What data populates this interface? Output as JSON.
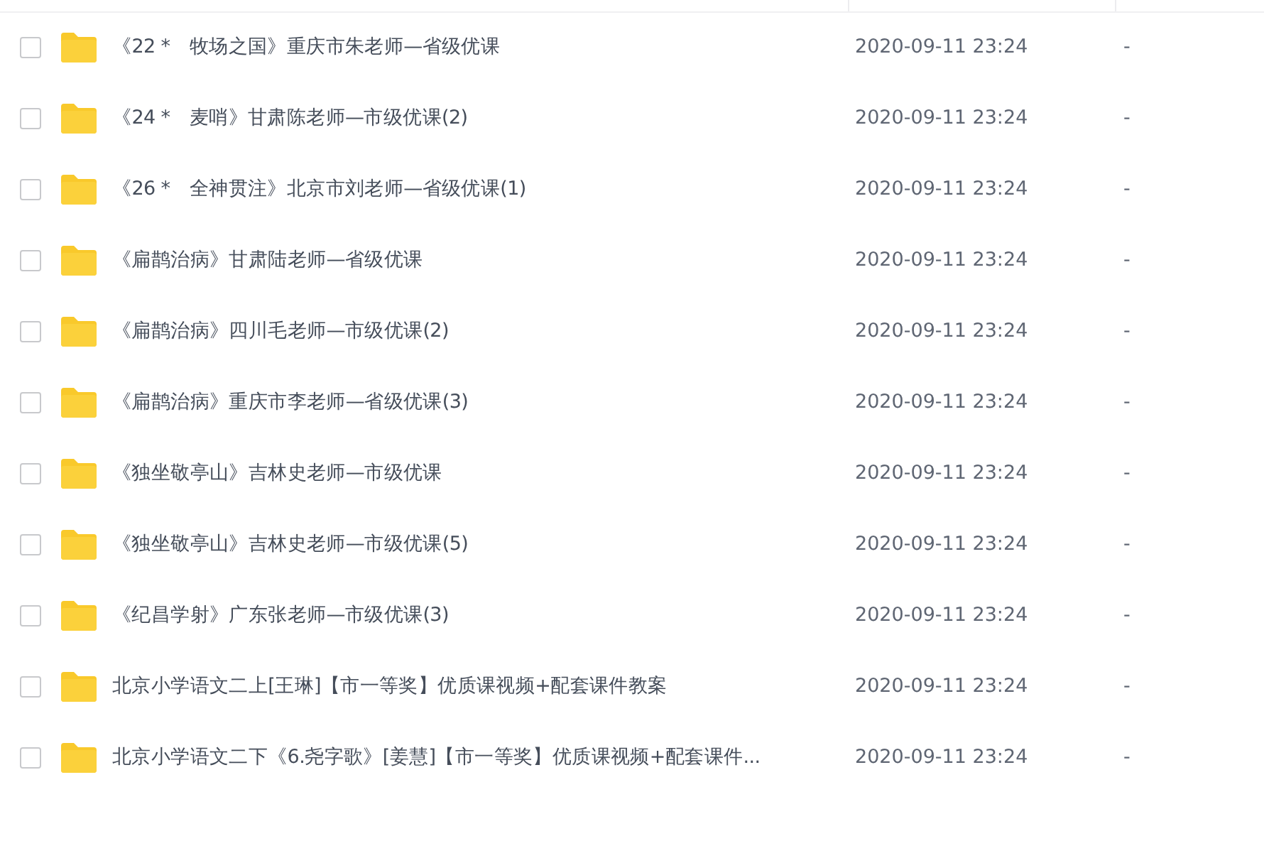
{
  "table": {
    "rows": [
      {
        "checked": false,
        "name": "《22 *　牧场之国》重庆市朱老师—省级优课",
        "modified": "2020-09-11 23:24",
        "size": "-"
      },
      {
        "checked": false,
        "name": "《24 *　麦哨》甘肃陈老师—市级优课(2)",
        "modified": "2020-09-11 23:24",
        "size": "-"
      },
      {
        "checked": false,
        "name": "《26 *　全神贯注》北京市刘老师—省级优课(1)",
        "modified": "2020-09-11 23:24",
        "size": "-"
      },
      {
        "checked": false,
        "name": "《扁鹊治病》甘肃陆老师—省级优课",
        "modified": "2020-09-11 23:24",
        "size": "-"
      },
      {
        "checked": false,
        "name": "《扁鹊治病》四川毛老师—市级优课(2)",
        "modified": "2020-09-11 23:24",
        "size": "-"
      },
      {
        "checked": false,
        "name": "《扁鹊治病》重庆市李老师—省级优课(3)",
        "modified": "2020-09-11 23:24",
        "size": "-"
      },
      {
        "checked": false,
        "name": "《独坐敬亭山》吉林史老师—市级优课",
        "modified": "2020-09-11 23:24",
        "size": "-"
      },
      {
        "checked": false,
        "name": "《独坐敬亭山》吉林史老师—市级优课(5)",
        "modified": "2020-09-11 23:24",
        "size": "-"
      },
      {
        "checked": false,
        "name": "《纪昌学射》广东张老师—市级优课(3)",
        "modified": "2020-09-11 23:24",
        "size": "-"
      },
      {
        "checked": false,
        "name": "北京小学语文二上[王琳]【市一等奖】优质课视频+配套课件教案",
        "modified": "2020-09-11 23:24",
        "size": "-"
      },
      {
        "checked": false,
        "name": "北京小学语文二下《6.尧字歌》[姜慧]【市一等奖】优质课视频+配套课件...",
        "modified": "2020-09-11 23:24",
        "size": "-"
      }
    ]
  }
}
